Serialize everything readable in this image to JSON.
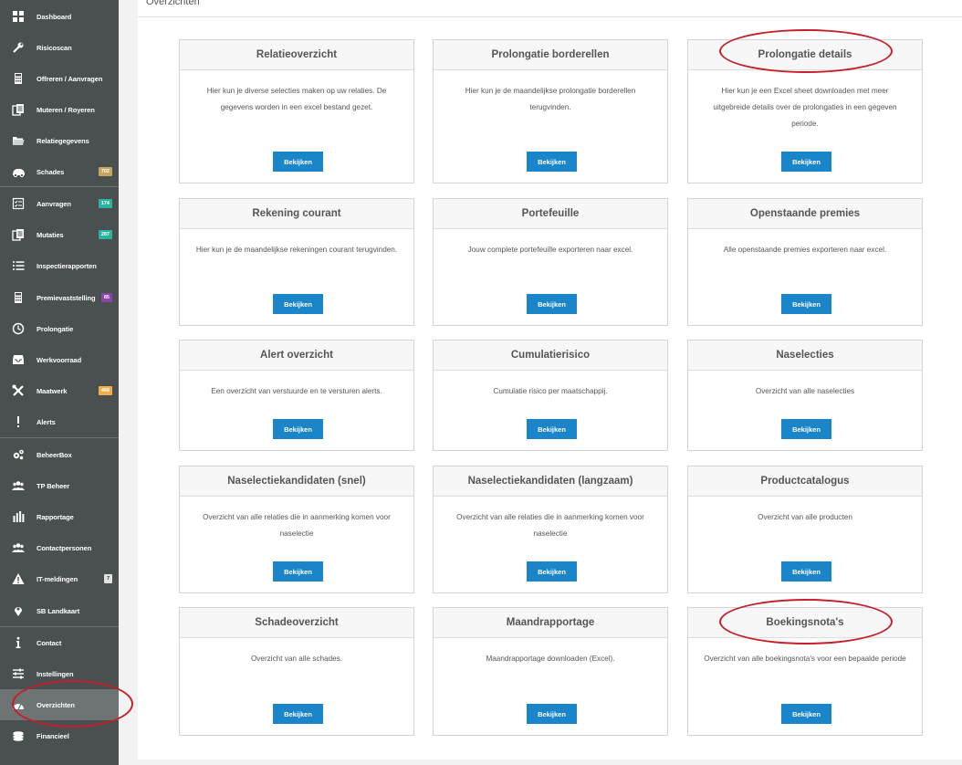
{
  "sidebar": {
    "items": [
      {
        "label": "Dashboard",
        "icon": "grid-icon"
      },
      {
        "label": "Risicoscan",
        "icon": "wrench-icon"
      },
      {
        "label": "Offreren / Aanvragen",
        "icon": "calculator-icon"
      },
      {
        "label": "Muteren / Royeren",
        "icon": "documents-icon"
      },
      {
        "label": "Relatiegegevens",
        "icon": "folder-icon"
      },
      {
        "label": "Schades",
        "icon": "car-icon",
        "badge": "702",
        "badge_color": "#c3a65c"
      },
      {
        "label": "Aanvragen",
        "icon": "checklist-icon",
        "badge": "174",
        "badge_color": "#2bb39b"
      },
      {
        "label": "Mutaties",
        "icon": "documents-icon",
        "badge": "287",
        "badge_color": "#2bb39b"
      },
      {
        "label": "Inspectierapporten",
        "icon": "list-icon"
      },
      {
        "label": "Premievaststelling",
        "icon": "calculator-icon",
        "badge": "85",
        "badge_color": "#8e44ad"
      },
      {
        "label": "Prolongatie",
        "icon": "clock-icon"
      },
      {
        "label": "Werkvoorraad",
        "icon": "inbox-icon"
      },
      {
        "label": "Maatwerk",
        "icon": "tools-icon",
        "badge": "466",
        "badge_color": "#f0ad4e"
      },
      {
        "label": "Alerts",
        "icon": "exclamation-icon"
      },
      {
        "label": "BeheerBox",
        "icon": "gears-icon"
      },
      {
        "label": "TP Beheer",
        "icon": "users-icon"
      },
      {
        "label": "Rapportage",
        "icon": "bar-chart-icon"
      },
      {
        "label": "Contactpersonen",
        "icon": "users-icon"
      },
      {
        "label": "IT-meldingen",
        "icon": "warning-icon",
        "badge": "7",
        "badge_color": "#e2e2e2"
      },
      {
        "label": "SB Landkaart",
        "icon": "map-pin-icon"
      },
      {
        "label": "Contact",
        "icon": "info-icon"
      },
      {
        "label": "Instellingen",
        "icon": "sliders-icon"
      },
      {
        "label": "Overzichten",
        "icon": "gauge-icon",
        "active": true
      },
      {
        "label": "Financieel",
        "icon": "coins-icon"
      }
    ]
  },
  "page": {
    "title": "Overzichten"
  },
  "button_label": "Bekijken",
  "cards": [
    {
      "title": "Relatieoverzicht",
      "desc": "Hier kun je diverse selecties maken op uw relaties. De gegevens worden in een excel bestand gezet."
    },
    {
      "title": "Prolongatie borderellen",
      "desc": "Hier kun je de maandelijkse prolongatie borderellen terugvinden."
    },
    {
      "title": "Prolongatie details",
      "desc": "Hier kun je een Excel sheet downloaden met meer uitgebreide details over de prolongaties in een gegeven periode."
    },
    {
      "title": "Rekening courant",
      "desc": "Hier kun je de maandelijkse rekeningen courant terugvinden."
    },
    {
      "title": "Portefeuille",
      "desc": "Jouw complete portefeuille exporteren naar excel."
    },
    {
      "title": "Openstaande premies",
      "desc": "Alle openstaande premies exporteren naar excel."
    },
    {
      "title": "Alert overzicht",
      "desc": "Een overzicht van verstuurde en te versturen alerts."
    },
    {
      "title": "Cumulatierisico",
      "desc": "Cumulatie risico per maatschappij."
    },
    {
      "title": "Naselecties",
      "desc": "Overzicht van alle naselecties"
    },
    {
      "title": "Naselectiekandidaten (snel)",
      "desc": "Overzicht van alle relaties die in aanmerking komen voor naselectie"
    },
    {
      "title": "Naselectiekandidaten (langzaam)",
      "desc": "Overzicht van alle relaties die in aanmerking komen voor naselectie"
    },
    {
      "title": "Productcatalogus",
      "desc": "Overzicht van alle producten"
    },
    {
      "title": "Schadeoverzicht",
      "desc": "Overzicht van alle schades."
    },
    {
      "title": "Maandrapportage",
      "desc": "Maandrapportage downloaden (Excel)."
    },
    {
      "title": "Boekingsnota's",
      "desc": "Overzicht van alle boekingsnota's voor een bepaalde periode"
    }
  ],
  "colors": {
    "sidebar": "#4a4f50",
    "button": "#1a85c9",
    "annotation": "#c4202b"
  }
}
